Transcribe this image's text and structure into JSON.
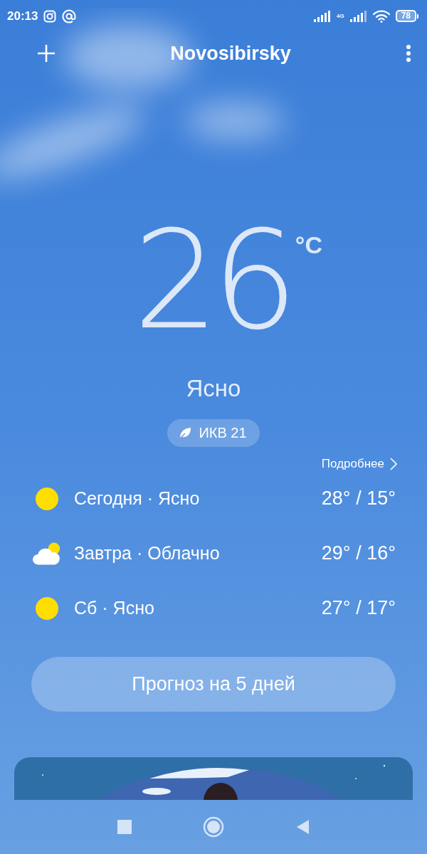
{
  "status_bar": {
    "time": "20:13",
    "network": "4G",
    "battery": "78"
  },
  "header": {
    "city": "Novosibirsky"
  },
  "current": {
    "temperature": "26",
    "unit": "°C",
    "condition": "Ясно",
    "aqi": "ИКВ 21"
  },
  "details_link": "Подробнее",
  "forecast": [
    {
      "kind": "sun",
      "label": "Сегодня · Ясно",
      "temps": "28° / 15°"
    },
    {
      "kind": "cloud_sun",
      "label": "Завтра · Облачно",
      "temps": "29° / 16°"
    },
    {
      "kind": "sun",
      "label": "Сб · Ясно",
      "temps": "27° / 17°"
    }
  ],
  "forecast_button": "Прогноз на 5 дней"
}
